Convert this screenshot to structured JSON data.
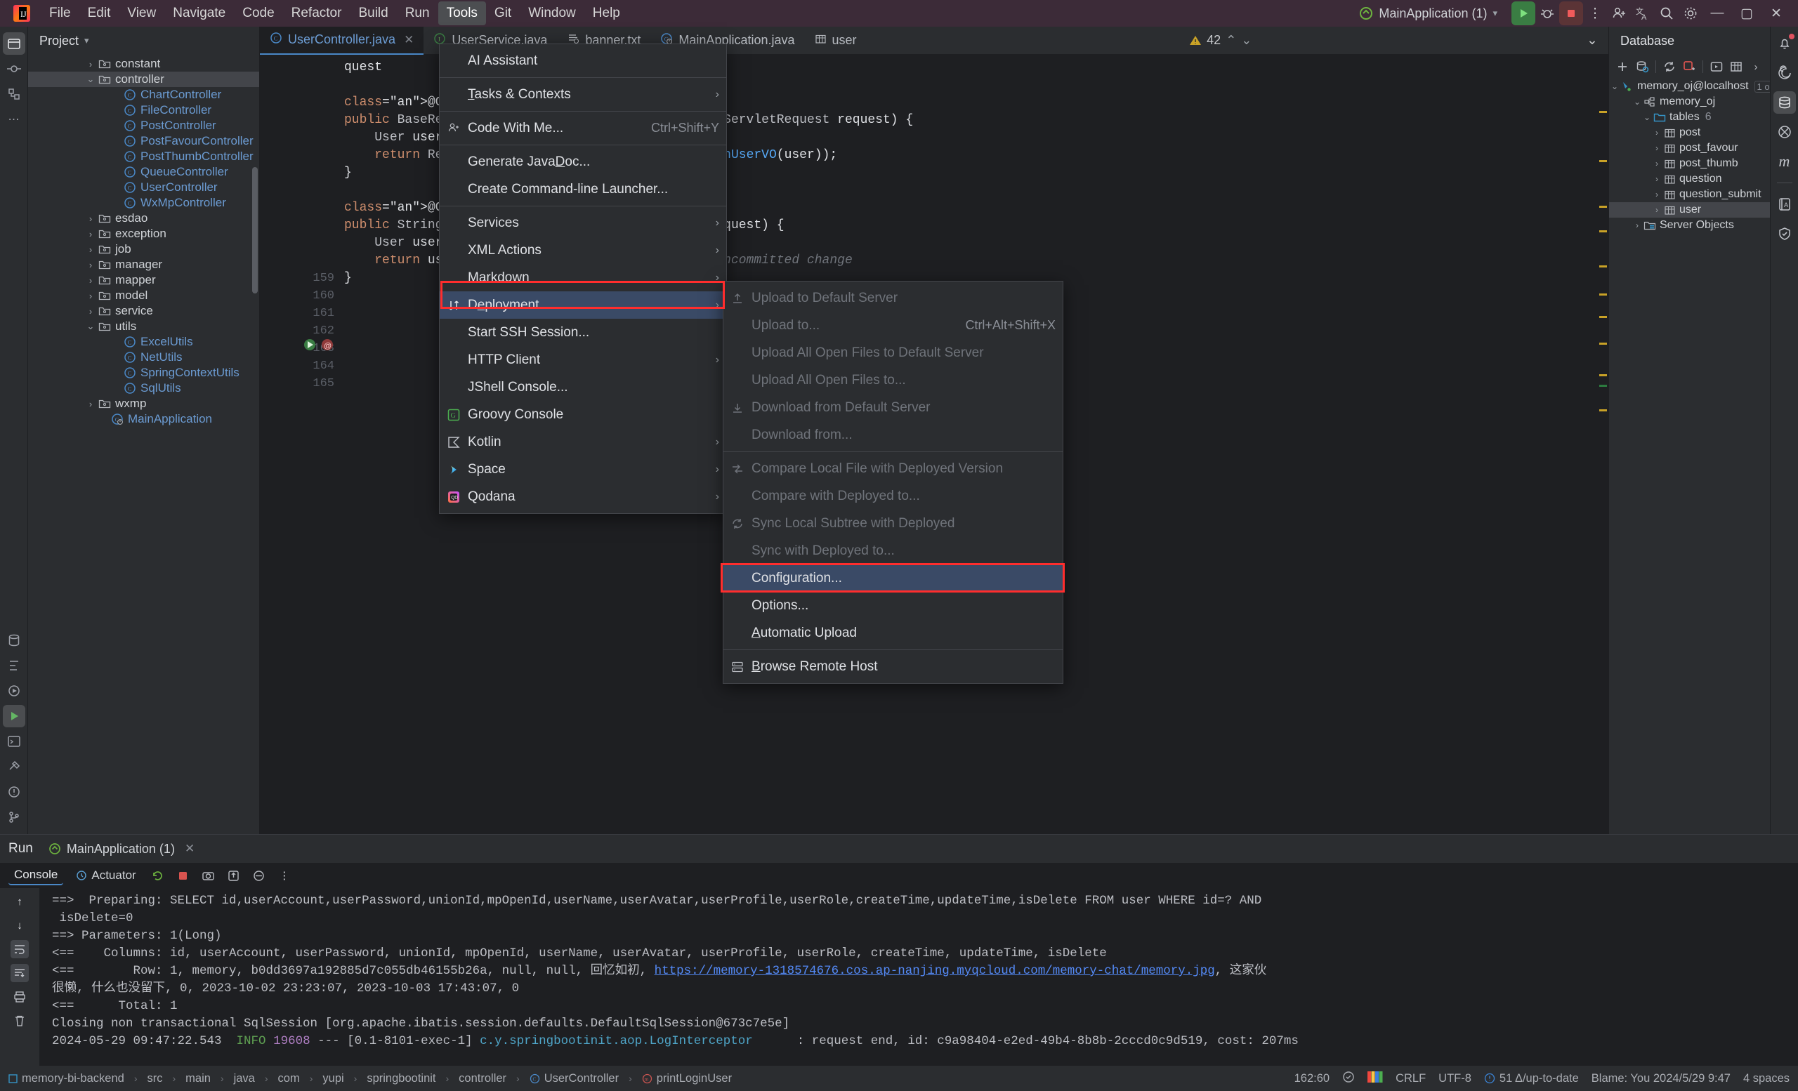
{
  "titlebar": {
    "menus": [
      "File",
      "Edit",
      "View",
      "Navigate",
      "Code",
      "Refactor",
      "Build",
      "Run",
      "Tools",
      "Git",
      "Window",
      "Help"
    ],
    "active_menu": "Tools",
    "run_config": "MainApplication (1)",
    "icons": [
      "run-icon",
      "debug-icon",
      "stop-icon",
      "more-icon",
      "add-user-icon",
      "translate-icon",
      "search-icon",
      "settings-icon"
    ],
    "window_controls": [
      "minimize",
      "maximize",
      "close"
    ]
  },
  "left_rail": {
    "top": [
      "project-icon",
      "commit-icon",
      "structure-icon",
      "more-tool-windows-icon"
    ],
    "bottom": [
      "database-icon",
      "structure2-icon",
      "services-icon",
      "run-icon",
      "terminal-icon",
      "build-icon",
      "problems-icon",
      "git-icon"
    ]
  },
  "project": {
    "title": "Project",
    "tree": [
      {
        "indent": 4,
        "arrow": "right",
        "icon": "folder-icon",
        "label": "constant",
        "kind": "folder"
      },
      {
        "indent": 4,
        "arrow": "down",
        "icon": "folder-icon",
        "label": "controller",
        "kind": "folder",
        "selected": true
      },
      {
        "indent": 6,
        "arrow": "none",
        "icon": "class-icon",
        "label": "ChartController",
        "kind": "class"
      },
      {
        "indent": 6,
        "arrow": "none",
        "icon": "class-icon",
        "label": "FileController",
        "kind": "class"
      },
      {
        "indent": 6,
        "arrow": "none",
        "icon": "class-icon",
        "label": "PostController",
        "kind": "class"
      },
      {
        "indent": 6,
        "arrow": "none",
        "icon": "class-icon",
        "label": "PostFavourController",
        "kind": "class"
      },
      {
        "indent": 6,
        "arrow": "none",
        "icon": "class-icon",
        "label": "PostThumbController",
        "kind": "class"
      },
      {
        "indent": 6,
        "arrow": "none",
        "icon": "class-icon",
        "label": "QueueController",
        "kind": "class"
      },
      {
        "indent": 6,
        "arrow": "none",
        "icon": "class-icon",
        "label": "UserController",
        "kind": "class"
      },
      {
        "indent": 6,
        "arrow": "none",
        "icon": "class-icon",
        "label": "WxMpController",
        "kind": "class"
      },
      {
        "indent": 4,
        "arrow": "right",
        "icon": "folder-icon",
        "label": "esdao",
        "kind": "folder"
      },
      {
        "indent": 4,
        "arrow": "right",
        "icon": "folder-icon",
        "label": "exception",
        "kind": "folder"
      },
      {
        "indent": 4,
        "arrow": "right",
        "icon": "folder-icon",
        "label": "job",
        "kind": "folder"
      },
      {
        "indent": 4,
        "arrow": "right",
        "icon": "folder-icon",
        "label": "manager",
        "kind": "folder"
      },
      {
        "indent": 4,
        "arrow": "right",
        "icon": "folder-icon",
        "label": "mapper",
        "kind": "folder"
      },
      {
        "indent": 4,
        "arrow": "right",
        "icon": "folder-icon",
        "label": "model",
        "kind": "folder"
      },
      {
        "indent": 4,
        "arrow": "right",
        "icon": "folder-icon",
        "label": "service",
        "kind": "folder"
      },
      {
        "indent": 4,
        "arrow": "down",
        "icon": "folder-icon",
        "label": "utils",
        "kind": "folder"
      },
      {
        "indent": 6,
        "arrow": "none",
        "icon": "class-icon",
        "label": "ExcelUtils",
        "kind": "class"
      },
      {
        "indent": 6,
        "arrow": "none",
        "icon": "class-icon",
        "label": "NetUtils",
        "kind": "class"
      },
      {
        "indent": 6,
        "arrow": "none",
        "icon": "class-icon",
        "label": "SpringContextUtils",
        "kind": "class"
      },
      {
        "indent": 6,
        "arrow": "none",
        "icon": "class-icon",
        "label": "SqlUtils",
        "kind": "class"
      },
      {
        "indent": 4,
        "arrow": "right",
        "icon": "folder-icon",
        "label": "wxmp",
        "kind": "folder"
      },
      {
        "indent": 5,
        "arrow": "none",
        "icon": "spring-class-icon",
        "label": "MainApplication",
        "kind": "class"
      }
    ]
  },
  "editor_tabs": [
    {
      "label": "UserController.java",
      "icon": "class-icon",
      "active": true,
      "closable": true
    },
    {
      "label": "UserService.java",
      "icon": "interface-icon",
      "active": false,
      "closable": false
    },
    {
      "label": "banner.txt",
      "icon": "text-file-icon",
      "active": false,
      "closable": false
    },
    {
      "label": "MainApplication.java",
      "icon": "spring-class-icon",
      "active": false,
      "closable": false
    },
    {
      "label": "user",
      "icon": "table-icon",
      "active": false,
      "closable": false
    }
  ],
  "editor": {
    "warning_count": "42",
    "visible_gutter_lines": [
      "159",
      "160",
      "161",
      "162",
      "163",
      "164",
      "165"
    ],
    "code_lines": [
      "quest",
      "",
      "@GetMapping(\"/get/login\")",
      "public BaseResponse<LoginUserVO> getLoginUser(HttpServletRequest request) {",
      "    User user = userService.getLoginUser(request);",
      "    return ResultUtils.success(userService.getLoginUserVO(user));",
      "}",
      "",
      "@GetMapping(\"/print/login\")",
      "public String printLoginUser(HttpServletRequest request) {",
      "    User user = userService.getLoginUser(request);",
      "    return user.toString();",
      "}"
    ],
    "inlay_hint": "You, Moments ago • Uncommitted change"
  },
  "tools_menu": {
    "items": [
      {
        "label": "AI Assistant",
        "icon": "",
        "mnemonic": "",
        "submenu": false,
        "shortcut": "",
        "sep_after": true
      },
      {
        "label": "Tasks & Contexts",
        "mnemonic": "T",
        "submenu": true,
        "shortcut": "",
        "sep_after": true
      },
      {
        "label": "Code With Me...",
        "icon": "code-with-me-icon",
        "submenu": false,
        "shortcut": "Ctrl+Shift+Y",
        "sep_after": true
      },
      {
        "label": "Generate JavaDoc...",
        "mnemonic": "D",
        "submenu": false,
        "shortcut": ""
      },
      {
        "label": "Create Command-line Launcher...",
        "submenu": false,
        "shortcut": "",
        "sep_after": true
      },
      {
        "label": "Services",
        "submenu": true,
        "shortcut": ""
      },
      {
        "label": "XML Actions",
        "submenu": true,
        "shortcut": ""
      },
      {
        "label": "Markdown",
        "submenu": true,
        "shortcut": ""
      },
      {
        "label": "Deployment",
        "mnemonic": "e",
        "submenu": true,
        "shortcut": "",
        "icon": "deployment-icon",
        "selected": true,
        "highlighted": true
      },
      {
        "label": "Start SSH Session...",
        "submenu": false,
        "shortcut": ""
      },
      {
        "label": "HTTP Client",
        "submenu": true,
        "shortcut": ""
      },
      {
        "label": "JShell Console...",
        "submenu": false,
        "shortcut": ""
      },
      {
        "label": "Groovy Console",
        "icon": "groovy-icon",
        "submenu": false,
        "shortcut": ""
      },
      {
        "label": "Kotlin",
        "icon": "kotlin-icon",
        "submenu": true,
        "shortcut": ""
      },
      {
        "label": "Space",
        "icon": "space-icon",
        "submenu": true,
        "shortcut": ""
      },
      {
        "label": "Qodana",
        "icon": "qodana-icon",
        "submenu": true,
        "shortcut": ""
      }
    ]
  },
  "deployment_submenu": {
    "items": [
      {
        "label": "Upload to Default Server",
        "icon": "upload-icon",
        "disabled": true,
        "shortcut": ""
      },
      {
        "label": "Upload to...",
        "disabled": true,
        "shortcut": "Ctrl+Alt+Shift+X"
      },
      {
        "label": "Upload All Open Files to Default Server",
        "disabled": true,
        "shortcut": ""
      },
      {
        "label": "Upload All Open Files to...",
        "disabled": true,
        "shortcut": ""
      },
      {
        "label": "Download from Default Server",
        "icon": "download-icon",
        "disabled": true,
        "shortcut": ""
      },
      {
        "label": "Download from...",
        "disabled": true,
        "shortcut": "",
        "sep_after": true
      },
      {
        "label": "Compare Local File with Deployed Version",
        "icon": "compare-icon",
        "disabled": true,
        "shortcut": ""
      },
      {
        "label": "Compare with Deployed to...",
        "disabled": true,
        "shortcut": ""
      },
      {
        "label": "Sync Local Subtree with Deployed",
        "icon": "sync-icon",
        "disabled": true,
        "shortcut": ""
      },
      {
        "label": "Sync with Deployed to...",
        "disabled": true,
        "shortcut": ""
      },
      {
        "label": "Configuration...",
        "disabled": false,
        "shortcut": "",
        "selected": true,
        "highlighted": true
      },
      {
        "label": "Options...",
        "disabled": false,
        "shortcut": ""
      },
      {
        "label": "Automatic Upload",
        "mnemonic": "A",
        "disabled": false,
        "shortcut": "",
        "sep_after": true
      },
      {
        "label": "Browse Remote Host",
        "mnemonic": "B",
        "icon": "remote-host-icon",
        "disabled": false,
        "shortcut": ""
      }
    ]
  },
  "database": {
    "title": "Database",
    "toolbar_icons": [
      "add-icon",
      "datasource-properties-icon",
      "refresh-icon",
      "stop-icon",
      "open-console-icon",
      "table-editor-icon",
      "chevron-right-icon"
    ],
    "tree": [
      {
        "indent": 1,
        "arrow": "down",
        "icon": "datasource-icon",
        "label": "memory_oj@localhost",
        "badge": "1 o"
      },
      {
        "indent": 2,
        "arrow": "down",
        "icon": "schema-icon",
        "label": "memory_oj"
      },
      {
        "indent": 3,
        "arrow": "down",
        "icon": "folder-icon",
        "label": "tables",
        "count": "6"
      },
      {
        "indent": 4,
        "arrow": "right",
        "icon": "table-icon",
        "label": "post"
      },
      {
        "indent": 4,
        "arrow": "right",
        "icon": "table-icon",
        "label": "post_favour"
      },
      {
        "indent": 4,
        "arrow": "right",
        "icon": "table-icon",
        "label": "post_thumb"
      },
      {
        "indent": 4,
        "arrow": "right",
        "icon": "table-icon",
        "label": "question"
      },
      {
        "indent": 4,
        "arrow": "right",
        "icon": "table-icon",
        "label": "question_submit"
      },
      {
        "indent": 4,
        "arrow": "right",
        "icon": "table-icon",
        "label": "user",
        "selected": true
      },
      {
        "indent": 2,
        "arrow": "right",
        "icon": "server-objects-icon",
        "label": "Server Objects"
      }
    ]
  },
  "right_rail": {
    "icons": [
      "notifications-icon",
      "ai-icon",
      "database-icon",
      "maven-icon",
      "m-icon",
      "dictionary-icon",
      "shield-icon"
    ],
    "notification_dot": true
  },
  "run_panel": {
    "title": "Run",
    "tab_label": "MainApplication (1)",
    "tab_icon": "spring-boot-icon",
    "subtabs": [
      {
        "label": "Console",
        "active": true
      },
      {
        "label": "Actuator",
        "active": false,
        "icon": "actuator-icon"
      }
    ],
    "toolbar_icons": [
      "rerun-icon",
      "stop-icon",
      "camera-icon",
      "export-icon",
      "filter-icon",
      "more-icon"
    ],
    "side_icons": [
      "scroll-up-icon",
      "scroll-down-icon",
      "soft-wrap-icon",
      "scroll-to-end-icon",
      "print-icon",
      "clear-all-icon"
    ],
    "console_lines": [
      {
        "segments": [
          {
            "t": "==>  Preparing: SELECT id,userAccount,userPassword,unionId,mpOpenId,userName,userAvatar,userProfile,userRole,createTime,updateTime,isDelete FROM user WHERE id=? AND"
          }
        ]
      },
      {
        "segments": [
          {
            "t": " isDelete=0"
          }
        ]
      },
      {
        "segments": [
          {
            "t": "==> Parameters: 1(Long)"
          }
        ]
      },
      {
        "segments": [
          {
            "t": "<==    Columns: id, userAccount, userPassword, unionId, mpOpenId, userName, userAvatar, userProfile, userRole, createTime, updateTime, isDelete"
          }
        ]
      },
      {
        "segments": [
          {
            "t": "<==        Row: 1, memory, b0dd3697a192885d7c055db46155b26a, null, null, 回忆如初, "
          },
          {
            "t": "https://memory-1318574676.cos.ap-nanjing.myqcloud.com/memory-chat/memory.jpg",
            "c": "cl-link"
          },
          {
            "t": ", 这家伙"
          }
        ]
      },
      {
        "segments": [
          {
            "t": "很懒, 什么也没留下, 0, 2023-10-02 23:23:07, 2023-10-03 17:43:07, 0"
          }
        ]
      },
      {
        "segments": [
          {
            "t": "<==      Total: 1"
          }
        ]
      },
      {
        "segments": [
          {
            "t": "Closing non transactional SqlSession [org.apache.ibatis.session.defaults.DefaultSqlSession@673c7e5e]"
          }
        ]
      },
      {
        "segments": [
          {
            "t": "2024-05-29 09:47:22.543  "
          },
          {
            "t": "INFO",
            "c": "cl-info"
          },
          {
            "t": " "
          },
          {
            "t": "19608",
            "c": "cl-pid"
          },
          {
            "t": " --- [0.1-8101-exec-1] "
          },
          {
            "t": "c.y.springbootinit.aop.LogInterceptor",
            "c": "cl-cls"
          },
          {
            "t": "      : request end, id: c9a98404-e2ed-49b4-8b8b-2cccd0c9d519, cost: 207ms"
          }
        ]
      }
    ]
  },
  "statusbar": {
    "breadcrumb": [
      "memory-bi-backend",
      "src",
      "main",
      "java",
      "com",
      "yupi",
      "springbootinit",
      "controller",
      "UserController",
      "printLoginUser"
    ],
    "caret": "162:60",
    "line_separator": "CRLF",
    "encoding": "UTF-8",
    "vcs_status": "51 Δ/up-to-date",
    "blame": "Blame: You 2024/5/29 9:47",
    "indent": "4 spaces"
  }
}
